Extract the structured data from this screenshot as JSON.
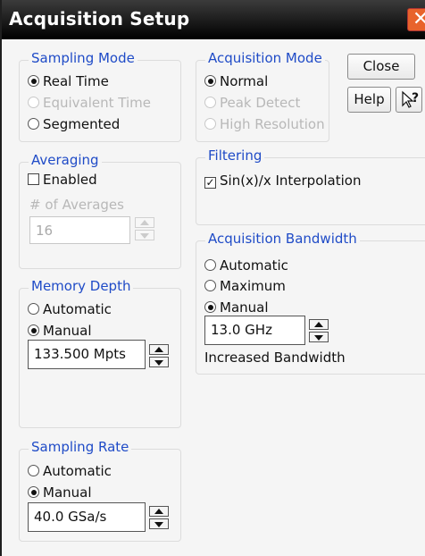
{
  "window": {
    "title": "Acquisition Setup",
    "close_glyph": "✕"
  },
  "buttons": {
    "close": "Close",
    "help": "Help",
    "whats_this": "?"
  },
  "sampling_mode": {
    "title": "Sampling Mode",
    "options": [
      {
        "label": "Real Time",
        "selected": true,
        "enabled": true
      },
      {
        "label": "Equivalent Time",
        "selected": false,
        "enabled": false
      },
      {
        "label": "Segmented",
        "selected": false,
        "enabled": true
      }
    ]
  },
  "acquisition_mode": {
    "title": "Acquisition Mode",
    "options": [
      {
        "label": "Normal",
        "selected": true,
        "enabled": true
      },
      {
        "label": "Peak Detect",
        "selected": false,
        "enabled": false
      },
      {
        "label": "High Resolution",
        "selected": false,
        "enabled": false
      }
    ]
  },
  "averaging": {
    "title": "Averaging",
    "enabled_label": "Enabled",
    "enabled_checked": false,
    "count_label": "# of Averages",
    "count_value": "16"
  },
  "filtering": {
    "title": "Filtering",
    "sinx_label": "Sin(x)/x Interpolation",
    "sinx_checked": true
  },
  "memory_depth": {
    "title": "Memory Depth",
    "automatic": "Automatic",
    "manual": "Manual",
    "selected": "Manual",
    "value": "133.500 Mpts"
  },
  "acquisition_bandwidth": {
    "title": "Acquisition Bandwidth",
    "automatic": "Automatic",
    "maximum": "Maximum",
    "manual": "Manual",
    "selected": "Manual",
    "value": "13.0 GHz",
    "note": "Increased Bandwidth"
  },
  "sampling_rate": {
    "title": "Sampling Rate",
    "automatic": "Automatic",
    "manual": "Manual",
    "selected": "Manual",
    "value": "40.0 GSa/s"
  }
}
